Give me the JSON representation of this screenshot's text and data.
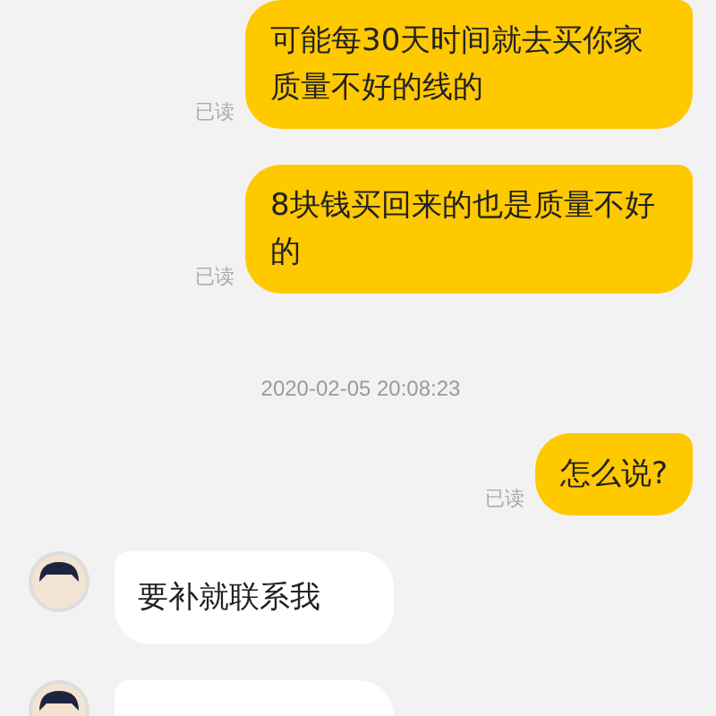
{
  "messages": [
    {
      "kind": "outgoing",
      "text": "可能每30天时间就去买你家质量不好的线的",
      "status": "已读"
    },
    {
      "kind": "outgoing",
      "text": "8块钱买回来的也是质量不好的",
      "status": "已读"
    },
    {
      "kind": "time",
      "text": "2020-02-05 20:08:23"
    },
    {
      "kind": "outgoing",
      "text": "怎么说?",
      "status": "已读"
    },
    {
      "kind": "incoming",
      "text": "要补就联系我"
    },
    {
      "kind": "incoming"
    }
  ]
}
